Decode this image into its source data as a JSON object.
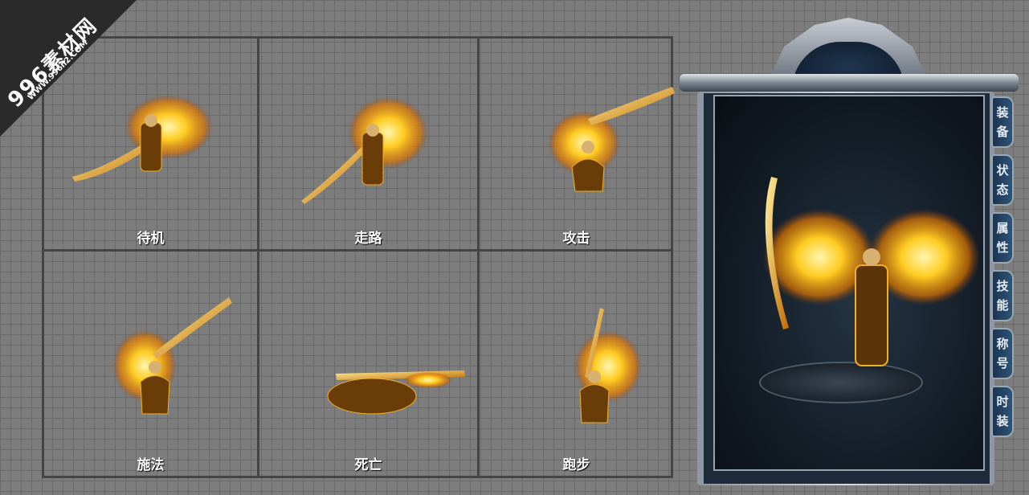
{
  "watermark": {
    "brand": "996素材网",
    "url": "WWW.996n2.COM"
  },
  "cells": [
    {
      "label": "待机"
    },
    {
      "label": "走路"
    },
    {
      "label": "攻击"
    },
    {
      "label": "施法"
    },
    {
      "label": "死亡"
    },
    {
      "label": "跑步"
    }
  ],
  "panel": {
    "tabs": [
      {
        "line1": "装",
        "line2": "备"
      },
      {
        "line1": "状",
        "line2": "态"
      },
      {
        "line1": "属",
        "line2": "性"
      },
      {
        "line1": "技",
        "line2": "能"
      },
      {
        "line1": "称",
        "line2": "号"
      },
      {
        "line1": "时",
        "line2": "装"
      }
    ]
  },
  "colors": {
    "gold": "#f5c518",
    "flame": "#ff9a00",
    "background": "#7d7d7d",
    "panel_blue": "#1d2b3a"
  }
}
